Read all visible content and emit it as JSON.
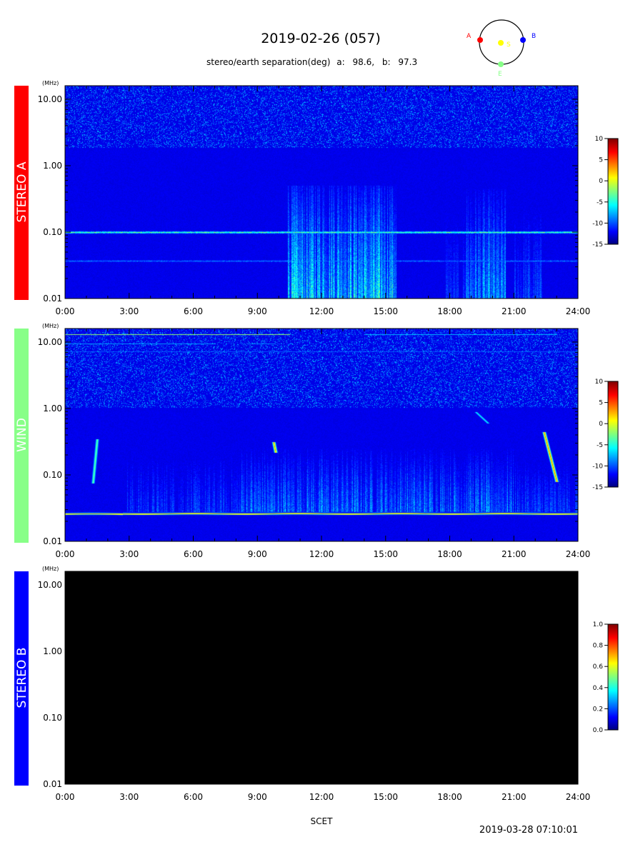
{
  "header": {
    "title": "2019-02-26 (057)",
    "separation_label": "stereo/earth separation(deg)",
    "sep_a_label": "a:",
    "sep_a_value": "98.6,",
    "sep_b_label": "b:",
    "sep_b_value": "97.3"
  },
  "orbit_diagram": {
    "labels": {
      "a": "A",
      "b": "B",
      "sun": "S",
      "earth": "E"
    },
    "colors": {
      "a": "#ff0000",
      "b": "#0000ff",
      "sun": "#ffff00",
      "earth": "#88ff88"
    }
  },
  "footer": {
    "xlabel": "SCET",
    "timestamp": "2019-03-28 07:10:01"
  },
  "chart_data": [
    {
      "type": "heatmap",
      "panel": "STEREO A",
      "panel_color": "#ff0000",
      "label_color": "#ffffff",
      "y_unit": "(MHz)",
      "y_scale": "log",
      "ylim": [
        0.01,
        16
      ],
      "y_ticks": [
        0.01,
        0.1,
        1.0,
        10.0
      ],
      "y_tick_labels": [
        "0.01",
        "0.10",
        "1.00",
        "10.00"
      ],
      "xlim": [
        0,
        24
      ],
      "x_ticks": [
        0,
        3,
        6,
        9,
        12,
        15,
        18,
        21,
        24
      ],
      "x_tick_labels": [
        "0:00",
        "3:00",
        "6:00",
        "9:00",
        "12:00",
        "15:00",
        "18:00",
        "21:00",
        "24:00"
      ],
      "colorbar": {
        "range": [
          -15,
          10
        ],
        "ticks": [
          -15,
          -10,
          -5,
          0,
          5,
          10
        ],
        "tick_labels": [
          "-15",
          "-10",
          "-5",
          "0",
          "5",
          "10"
        ]
      },
      "features": {
        "activity_bursts": [
          {
            "x": [
              10.4,
              15.5
            ],
            "y": [
              0.01,
              0.5
            ],
            "level": 0.55
          },
          {
            "x": [
              17.8,
              18.4
            ],
            "y": [
              0.01,
              0.3
            ],
            "level": 0.28
          },
          {
            "x": [
              18.6,
              20.6
            ],
            "y": [
              0.01,
              0.45
            ],
            "level": 0.42
          },
          {
            "x": [
              21.0,
              22.4
            ],
            "y": [
              0.01,
              0.3
            ],
            "level": 0.3
          }
        ],
        "emission_bands": [
          {
            "y": 0.1,
            "level": 0.55
          },
          {
            "y": 0.037,
            "level": 0.3
          }
        ],
        "high_band_floor": 1.9
      }
    },
    {
      "type": "heatmap",
      "panel": "WIND",
      "panel_color": "#88ff88",
      "label_color": "#ffffff",
      "y_unit": "(MHz)",
      "y_scale": "log",
      "ylim": [
        0.01,
        16
      ],
      "y_ticks": [
        0.01,
        0.1,
        1.0,
        10.0
      ],
      "y_tick_labels": [
        "0.01",
        "0.10",
        "1.00",
        "10.00"
      ],
      "xlim": [
        0,
        24
      ],
      "x_ticks": [
        0,
        3,
        6,
        9,
        12,
        15,
        18,
        21,
        24
      ],
      "x_tick_labels": [
        "0:00",
        "3:00",
        "6:00",
        "9:00",
        "12:00",
        "15:00",
        "18:00",
        "21:00",
        "24:00"
      ],
      "colorbar": {
        "range": [
          -15,
          10
        ],
        "ticks": [
          -15,
          -10,
          -5,
          0,
          5,
          10
        ],
        "tick_labels": [
          "-15",
          "-10",
          "-5",
          "0",
          "5",
          "10"
        ]
      },
      "features": {
        "plasma_line": {
          "y": 0.026,
          "level": 0.72
        },
        "activity_bursts": [
          {
            "x": [
              2.8,
              8.2
            ],
            "y": [
              0.028,
              0.25
            ],
            "level": 0.28
          },
          {
            "x": [
              8.2,
              21.0
            ],
            "y": [
              0.028,
              0.25
            ],
            "level": 0.38
          },
          {
            "x": [
              21.0,
              24.0
            ],
            "y": [
              0.028,
              0.2
            ],
            "level": 0.3
          }
        ],
        "type_iii_bursts": [
          {
            "t_start": 1.5,
            "t_end": 1.3,
            "f_start": 0.35,
            "f_end": 0.075,
            "level": 0.5
          },
          {
            "t_start": 9.75,
            "t_end": 9.85,
            "f_start": 0.32,
            "f_end": 0.22,
            "level": 0.75
          },
          {
            "t_start": 22.4,
            "t_end": 23.0,
            "f_start": 0.45,
            "f_end": 0.08,
            "level": 0.78
          },
          {
            "t_start": 19.2,
            "t_end": 19.8,
            "f_start": 0.9,
            "f_end": 0.6,
            "level": 0.4
          }
        ],
        "high_lines": [
          {
            "y": 13.2,
            "x": [
              0.0,
              10.5
            ],
            "level": 0.75
          },
          {
            "y": 13.2,
            "x": [
              14.0,
              23.0
            ],
            "level": 0.45
          },
          {
            "y": 9.6,
            "x": [
              0.0,
              7.0
            ],
            "level": 0.55
          },
          {
            "y": 9.6,
            "x": [
              8.5,
              9.8
            ],
            "level": 0.5
          },
          {
            "y": 7.3,
            "x": [
              0.0,
              24.0
            ],
            "level": 0.35
          }
        ],
        "high_band_floor": 1.05
      }
    },
    {
      "type": "heatmap",
      "panel": "STEREO B",
      "panel_color": "#0000ff",
      "label_color": "#ffffff",
      "y_unit": "(MHz)",
      "y_scale": "log",
      "ylim": [
        0.01,
        16
      ],
      "y_ticks": [
        0.01,
        0.1,
        1.0,
        10.0
      ],
      "y_tick_labels": [
        "0.01",
        "0.10",
        "1.00",
        "10.00"
      ],
      "xlim": [
        0,
        24
      ],
      "x_ticks": [
        0,
        3,
        6,
        9,
        12,
        15,
        18,
        21,
        24
      ],
      "x_tick_labels": [
        "0:00",
        "3:00",
        "6:00",
        "9:00",
        "12:00",
        "15:00",
        "18:00",
        "21:00",
        "24:00"
      ],
      "colorbar": {
        "range": [
          0.0,
          1.0
        ],
        "ticks": [
          0.0,
          0.2,
          0.4,
          0.6,
          0.8,
          1.0
        ],
        "tick_labels": [
          "0.0",
          "0.2",
          "0.4",
          "0.6",
          "0.8",
          "1.0"
        ]
      },
      "no_data": true
    }
  ]
}
